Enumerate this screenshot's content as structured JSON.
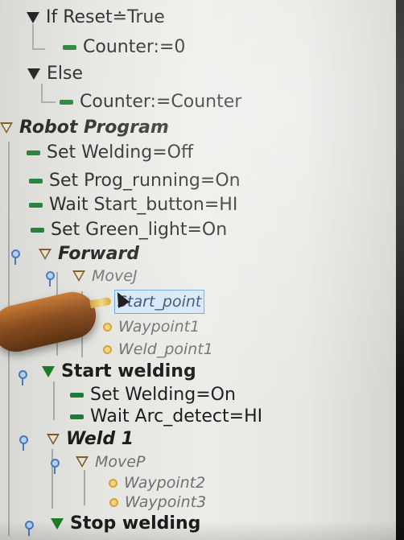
{
  "tree": {
    "if_reset_label": "If Reset≐True",
    "if_counter_label": "Counter:=0",
    "else_label": "Else",
    "else_counter_label": "Counter:=Counter",
    "robot_program_label": "Robot Program",
    "set_welding_off_label": "Set Welding=Off",
    "set_prog_running_on_label": "Set Prog_running=On",
    "wait_start_button_label": "Wait Start_button=HI",
    "set_green_light_on_label": "Set Green_light=On",
    "forward_label": "Forward",
    "movej_label": "MoveJ",
    "start_point_label": "Start_point",
    "waypoint1_label": "Waypoint1",
    "weld_point1_label": "Weld_point1",
    "start_welding_label": "Start welding",
    "set_welding_on_label": "Set Welding=On",
    "wait_arc_detect_label": "Wait Arc_detect=HI",
    "weld1_label": "Weld 1",
    "movep_label": "MoveP",
    "waypoint2_label": "Waypoint2",
    "waypoint3_label": "Waypoint3",
    "stop_welding_label": "Stop welding"
  },
  "colors": {
    "selection": "#d7e7f6",
    "command": "#1e7c34",
    "waypoint": "#d5a331",
    "pin": "#4b78b6"
  }
}
